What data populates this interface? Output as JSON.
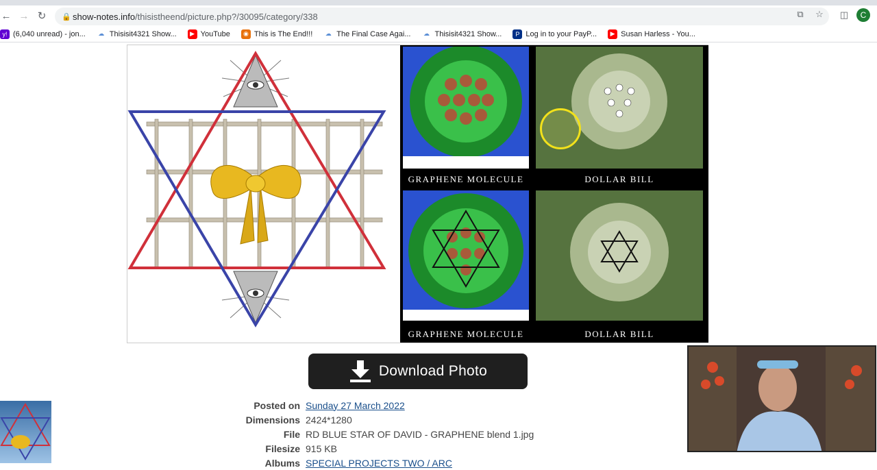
{
  "browser": {
    "url_domain": "show-notes.info",
    "url_path": "/thisistheend/picture.php?/30095/category/338",
    "profile_initial": "C"
  },
  "bookmarks": [
    {
      "label": "(6,040 unread) - jon...",
      "icon": "yahoo-mail-icon",
      "color": "#6001d2"
    },
    {
      "label": "Thisisit4321 Show...",
      "icon": "cloud-icon",
      "color": "#5b8fd6"
    },
    {
      "label": "YouTube",
      "icon": "youtube-icon",
      "color": "#ff0000"
    },
    {
      "label": "This is The End!!!",
      "icon": "site-icon",
      "color": "#e8710a"
    },
    {
      "label": "The Final Case Agai...",
      "icon": "cloud-icon",
      "color": "#5b8fd6"
    },
    {
      "label": "Thisisit4321 Show...",
      "icon": "cloud-icon",
      "color": "#5b8fd6"
    },
    {
      "label": "Log in to your PayP...",
      "icon": "paypal-icon",
      "color": "#003087"
    },
    {
      "label": "Susan Harless - You...",
      "icon": "youtube-icon",
      "color": "#ff0000"
    }
  ],
  "photo": {
    "captions": {
      "top_left": "GRAPHENE MOLECULE",
      "top_right": "DOLLAR BILL",
      "bottom_left": "GRAPHENE MOLECULE",
      "bottom_right": "DOLLAR BILL"
    }
  },
  "download": {
    "label": "Download Photo"
  },
  "meta": {
    "posted_label": "Posted on",
    "posted_value": "Sunday 27 March 2022",
    "dimensions_label": "Dimensions",
    "dimensions_value": "2424*1280",
    "file_label": "File",
    "file_value": "RD BLUE STAR OF DAVID - GRAPHENE blend 1.jpg",
    "filesize_label": "Filesize",
    "filesize_value": "915 KB",
    "albums_label": "Albums",
    "albums_value": "SPECIAL PROJECTS TWO / ARC"
  }
}
